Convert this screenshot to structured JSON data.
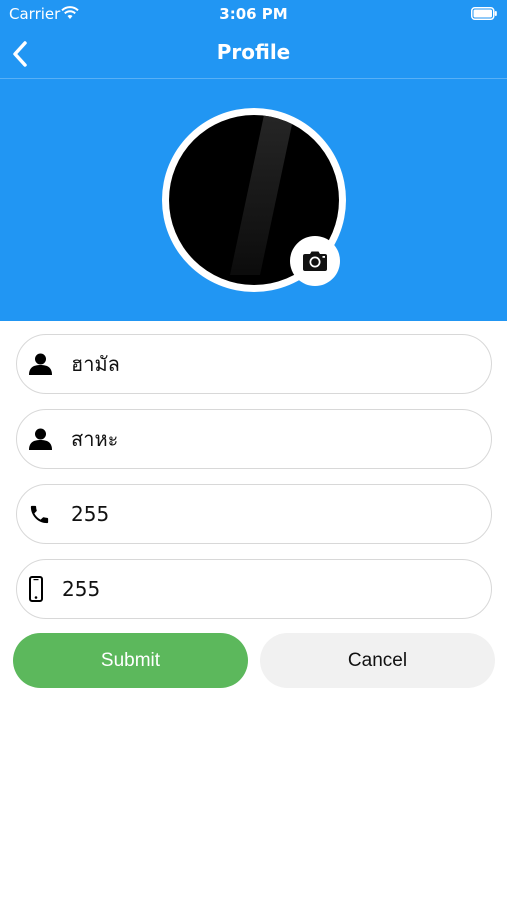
{
  "status_bar": {
    "carrier": "Carrier",
    "time": "3:06 PM"
  },
  "nav": {
    "title": "Profile",
    "back_icon": "chevron-left-icon"
  },
  "profile": {
    "avatar": "profile-photo",
    "camera_icon": "camera-icon"
  },
  "form": {
    "first_name": {
      "icon": "person-icon",
      "value": "ฮามัล"
    },
    "last_name": {
      "icon": "person-icon",
      "value": "สาหะ"
    },
    "phone": {
      "icon": "phone-icon",
      "value": "255"
    },
    "mobile": {
      "icon": "mobile-phone-icon",
      "value": "255"
    }
  },
  "actions": {
    "submit_label": "Submit",
    "cancel_label": "Cancel"
  },
  "colors": {
    "header": "#2196F3",
    "submit": "#5CB85C",
    "cancel": "#F1F1F1"
  }
}
